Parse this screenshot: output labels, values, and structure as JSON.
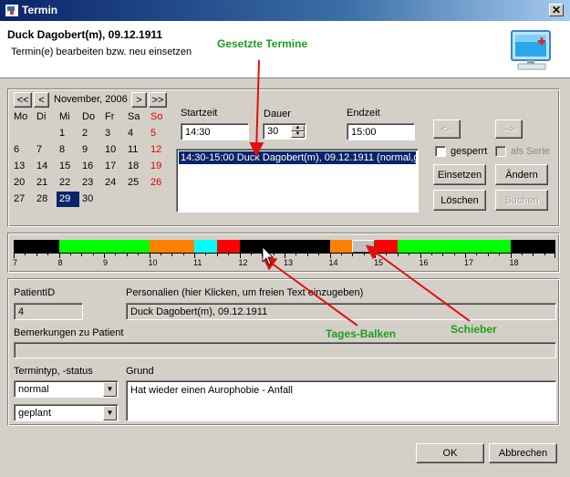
{
  "window": {
    "title": "Termin",
    "close": "✕"
  },
  "header": {
    "title": "Duck Dagobert(m), 09.12.1911",
    "subtitle": "Termin(e) bearbeiten bzw. neu einsetzen"
  },
  "calendar": {
    "prev_year": "<<",
    "prev_month": "<",
    "month_label": "November, 2006",
    "next_month": ">",
    "next_year": ">>",
    "weekdays": [
      "Mo",
      "Di",
      "Mi",
      "Do",
      "Fr",
      "Sa",
      "So"
    ],
    "weeks": [
      [
        "",
        "",
        "1",
        "2",
        "3",
        "4",
        "5"
      ],
      [
        "6",
        "7",
        "8",
        "9",
        "10",
        "11",
        "12"
      ],
      [
        "13",
        "14",
        "15",
        "16",
        "17",
        "18",
        "19"
      ],
      [
        "20",
        "21",
        "22",
        "23",
        "24",
        "25",
        "26"
      ],
      [
        "27",
        "28",
        "29",
        "30",
        "",
        "",
        ""
      ]
    ],
    "selected_day": "29"
  },
  "time": {
    "start_label": "Startzeit",
    "start_value": "14:30",
    "duration_label": "Dauer",
    "duration_value": "30",
    "end_label": "Endzeit",
    "end_value": "15:00"
  },
  "appointments": [
    "14:30-15:00 Duck Dagobert(m), 09.12.1911 (normal,g"
  ],
  "buttons": {
    "prev": "<--",
    "next": "-->",
    "insert": "Einsetzen",
    "change": "Ändern",
    "delete": "Löschen",
    "search": "Suchen",
    "ok": "OK",
    "cancel": "Abbrechen"
  },
  "checkboxes": {
    "blocked": "gesperrt",
    "series": "als Serie"
  },
  "timeline": {
    "hours": [
      "7",
      "8",
      "9",
      "10",
      "11",
      "12",
      "13",
      "14",
      "15",
      "16",
      "17",
      "18"
    ],
    "segments": [
      {
        "from": 7.0,
        "to": 8.0,
        "color": "#000000"
      },
      {
        "from": 8.0,
        "to": 10.0,
        "color": "#00ff00"
      },
      {
        "from": 10.0,
        "to": 11.0,
        "color": "#ff8000"
      },
      {
        "from": 11.0,
        "to": 11.5,
        "color": "#00ffff"
      },
      {
        "from": 11.5,
        "to": 12.0,
        "color": "#ff0000"
      },
      {
        "from": 12.0,
        "to": 14.0,
        "color": "#000000"
      },
      {
        "from": 14.0,
        "to": 14.5,
        "color": "#ff8000"
      },
      {
        "from": 14.5,
        "to": 15.0,
        "color": "#c0c0c0"
      },
      {
        "from": 15.0,
        "to": 15.5,
        "color": "#ff0000"
      },
      {
        "from": 15.5,
        "to": 18.0,
        "color": "#00ff00"
      },
      {
        "from": 18.0,
        "to": 19.0,
        "color": "#000000"
      }
    ],
    "slider_at": 14.5
  },
  "patient": {
    "id_label": "PatientID",
    "id_value": "4",
    "personal_label": "Personalien (hier Klicken, um freien Text einzugeben)",
    "personal_value": "Duck Dagobert(m), 09.12.1911",
    "remarks_label": "Bemerkungen zu Patient",
    "remarks_value": "",
    "type_label": "Termintyp, -status",
    "type_value": "normal",
    "status_value": "geplant",
    "reason_label": "Grund",
    "reason_value": "Hat wieder einen Aurophobie - Anfall"
  },
  "annotations": {
    "set_appointments": "Gesetzte Termine",
    "day_bar": "Tages-Balken",
    "slider": "Schieber"
  },
  "colors": {
    "annotation": "#1e9e1e",
    "arrow": "#e01010",
    "selection": "#0a246a"
  }
}
